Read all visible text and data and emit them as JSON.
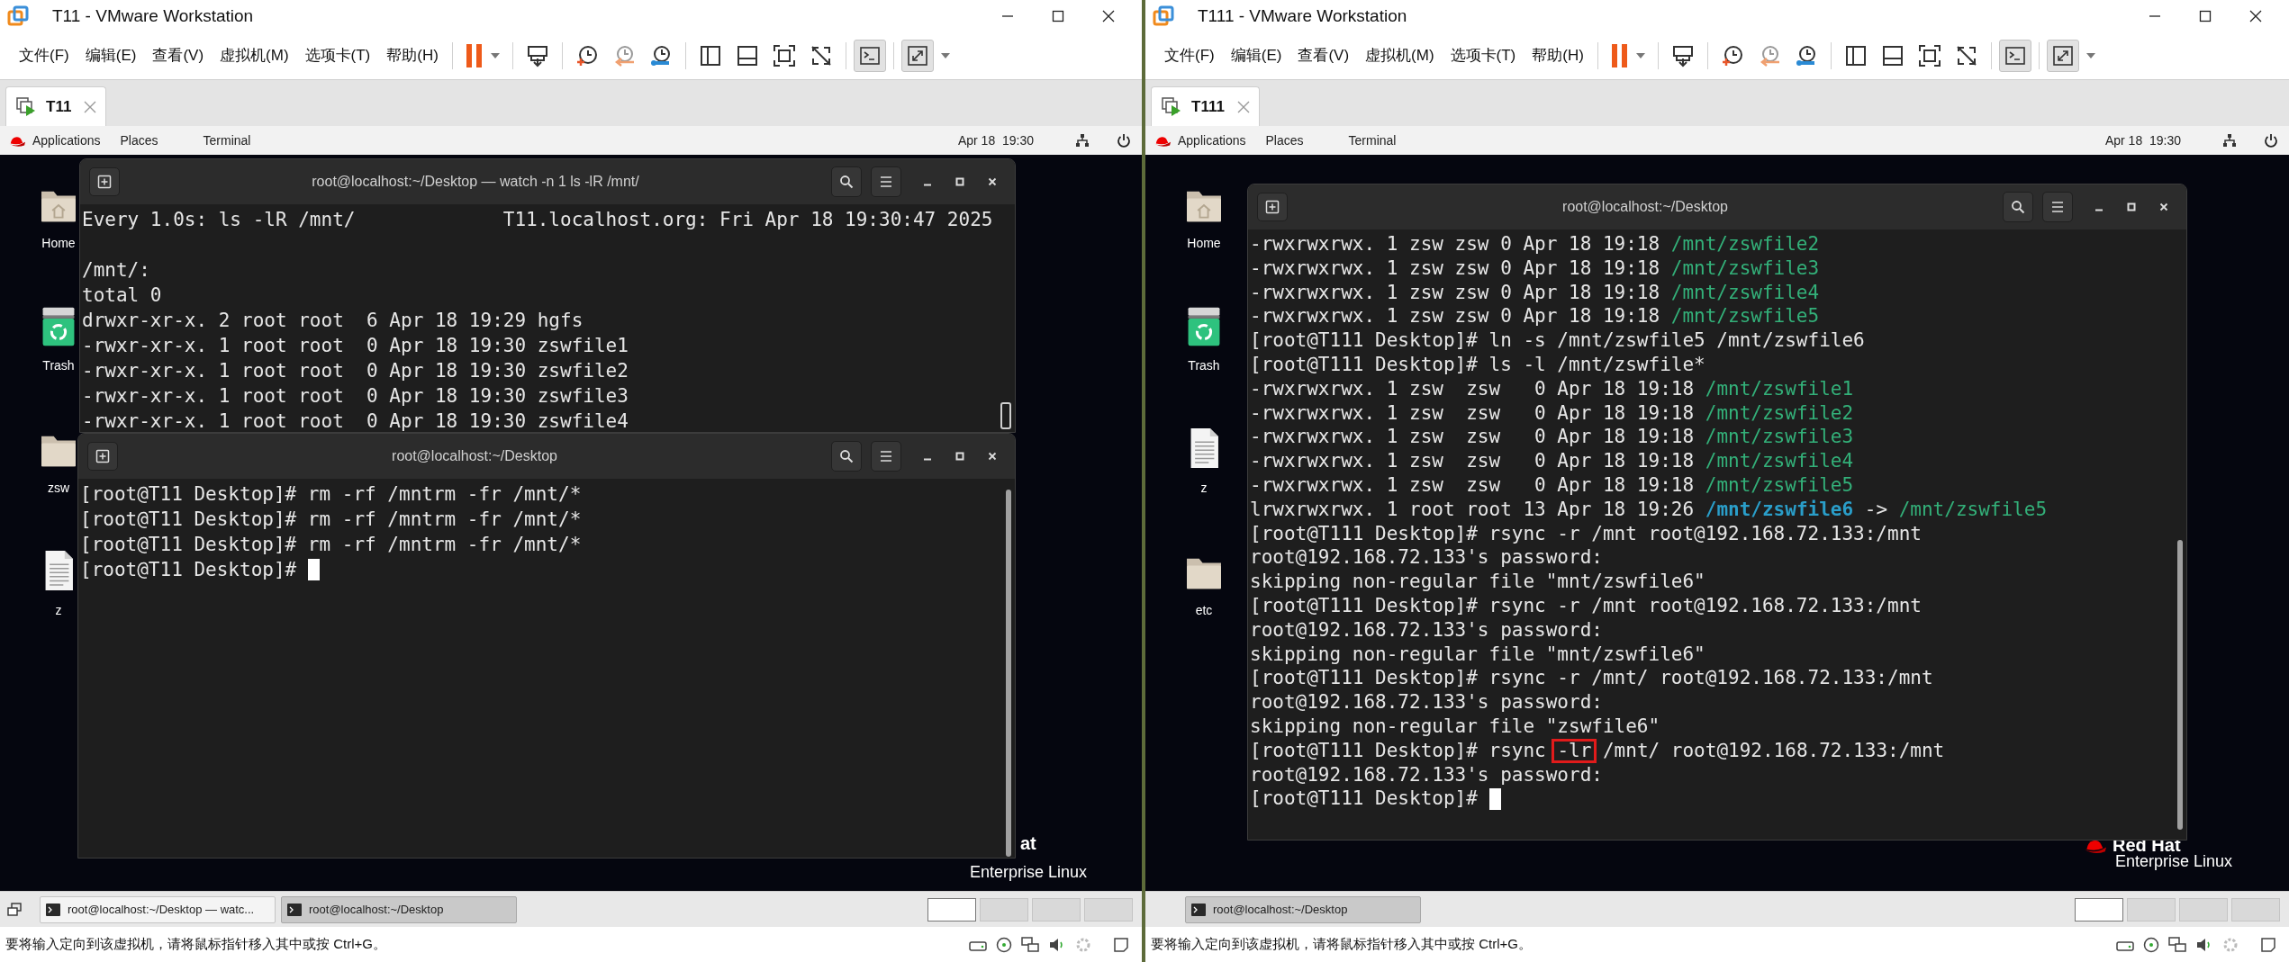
{
  "windows": [
    {
      "title": "T11 - VMware Workstation",
      "menus": [
        "文件(F)",
        "编辑(E)",
        "查看(V)",
        "虚拟机(M)",
        "选项卡(T)",
        "帮助(H)"
      ],
      "tabs": [
        {
          "label": "T11",
          "selected": true
        }
      ],
      "guest": {
        "top_bar": {
          "items": [
            "Applications",
            "Places",
            "Terminal"
          ],
          "clock": "Apr 18  19:30"
        },
        "desktop_icons": [
          {
            "label": "Home",
            "kind": "home"
          },
          {
            "label": "Trash",
            "kind": "trash"
          },
          {
            "label": "zsw",
            "kind": "folder"
          },
          {
            "label": "z",
            "kind": "file"
          }
        ],
        "terminals": [
          {
            "title": "root@localhost:~/Desktop — watch -n 1 ls -lR /mnt/",
            "cursor": false,
            "lines": [
              "Every 1.0s: ls -lR /mnt/             T11.localhost.org: Fri Apr 18 19:30:47 2025",
              {
                "kind": "blank"
              },
              "/mnt/:",
              "total 0",
              "drwxr-xr-x. 2 root root  6 Apr 18 19:29 hgfs",
              "-rwxr-xr-x. 1 root root  0 Apr 18 19:30 zswfile1",
              "-rwxr-xr-x. 1 root root  0 Apr 18 19:30 zswfile2",
              "-rwxr-xr-x. 1 root root  0 Apr 18 19:30 zswfile3",
              "-rwxr-xr-x. 1 root root  0 Apr 18 19:30 zswfile4"
            ]
          },
          {
            "title": "root@localhost:~/Desktop",
            "cursor": true,
            "lines": [
              "[root@T11 Desktop]# rm -rf /mntrm -fr /mnt/*",
              "[root@T11 Desktop]# rm -rf /mntrm -fr /mnt/*",
              "[root@T11 Desktop]# rm -rf /mntrm -fr /mnt/*",
              "[root@T11 Desktop]# "
            ]
          }
        ],
        "logo": {
          "brand": "at",
          "product": "Enterprise Linux"
        },
        "taskbar": {
          "items": [
            {
              "label": "root@localhost:~/Desktop — watc...",
              "selected": false
            },
            {
              "label": "root@localhost:~/Desktop",
              "selected": true
            }
          ],
          "workspaces": [
            {
              "selected": true
            },
            {
              "selected": false
            },
            {
              "selected": false
            },
            {
              "selected": false
            }
          ]
        }
      },
      "status_bar": "要将输入定向到该虚拟机，请将鼠标指针移入其中或按 Ctrl+G。"
    },
    {
      "title": "T111 - VMware Workstation",
      "menus": [
        "文件(F)",
        "编辑(E)",
        "查看(V)",
        "虚拟机(M)",
        "选项卡(T)",
        "帮助(H)"
      ],
      "tabs": [
        {
          "label": "T111",
          "selected": true
        }
      ],
      "guest": {
        "top_bar": {
          "items": [
            "Applications",
            "Places",
            "Terminal"
          ],
          "clock": "Apr 18  19:30"
        },
        "desktop_icons": [
          {
            "label": "Home",
            "kind": "home"
          },
          {
            "label": "Trash",
            "kind": "trash"
          },
          {
            "label": "z",
            "kind": "file"
          },
          {
            "label": "etc",
            "kind": "folder"
          }
        ],
        "terminals": [
          {
            "title": "root@localhost:~/Desktop",
            "cursor": true,
            "lines": [
              {
                "kind": "colored",
                "segments": [
                  {
                    "text": "-rwxrwxrwx. 1 zsw zsw 0 Apr 18 19:18 ",
                    "kind": "plain"
                  },
                  {
                    "text": "/mnt/zswfile2",
                    "kind": "file"
                  }
                ]
              },
              {
                "kind": "colored",
                "segments": [
                  {
                    "text": "-rwxrwxrwx. 1 zsw zsw 0 Apr 18 19:18 ",
                    "kind": "plain"
                  },
                  {
                    "text": "/mnt/zswfile3",
                    "kind": "file"
                  }
                ]
              },
              {
                "kind": "colored",
                "segments": [
                  {
                    "text": "-rwxrwxrwx. 1 zsw zsw 0 Apr 18 19:18 ",
                    "kind": "plain"
                  },
                  {
                    "text": "/mnt/zswfile4",
                    "kind": "file"
                  }
                ]
              },
              {
                "kind": "colored",
                "segments": [
                  {
                    "text": "-rwxrwxrwx. 1 zsw zsw 0 Apr 18 19:18 ",
                    "kind": "plain"
                  },
                  {
                    "text": "/mnt/zswfile5",
                    "kind": "file"
                  }
                ]
              },
              "[root@T111 Desktop]# ln -s /mnt/zswfile5 /mnt/zswfile6",
              "[root@T111 Desktop]# ls -l /mnt/zswfile*",
              {
                "kind": "colored",
                "segments": [
                  {
                    "text": "-rwxrwxrwx. 1 zsw  zsw   0 Apr 18 19:18 ",
                    "kind": "plain"
                  },
                  {
                    "text": "/mnt/zswfile1",
                    "kind": "file"
                  }
                ]
              },
              {
                "kind": "colored",
                "segments": [
                  {
                    "text": "-rwxrwxrwx. 1 zsw  zsw   0 Apr 18 19:18 ",
                    "kind": "plain"
                  },
                  {
                    "text": "/mnt/zswfile2",
                    "kind": "file"
                  }
                ]
              },
              {
                "kind": "colored",
                "segments": [
                  {
                    "text": "-rwxrwxrwx. 1 zsw  zsw   0 Apr 18 19:18 ",
                    "kind": "plain"
                  },
                  {
                    "text": "/mnt/zswfile3",
                    "kind": "file"
                  }
                ]
              },
              {
                "kind": "colored",
                "segments": [
                  {
                    "text": "-rwxrwxrwx. 1 zsw  zsw   0 Apr 18 19:18 ",
                    "kind": "plain"
                  },
                  {
                    "text": "/mnt/zswfile4",
                    "kind": "file"
                  }
                ]
              },
              {
                "kind": "colored",
                "segments": [
                  {
                    "text": "-rwxrwxrwx. 1 zsw  zsw   0 Apr 18 19:18 ",
                    "kind": "plain"
                  },
                  {
                    "text": "/mnt/zswfile5",
                    "kind": "file"
                  }
                ]
              },
              {
                "kind": "colored",
                "segments": [
                  {
                    "text": "lrwxrwxrwx. 1 root root 13 Apr 18 19:26 ",
                    "kind": "plain"
                  },
                  {
                    "text": "/mnt/zswfile6",
                    "kind": "symlink"
                  },
                  {
                    "text": " -> ",
                    "kind": "plain"
                  },
                  {
                    "text": "/mnt/zswfile5",
                    "kind": "file"
                  }
                ]
              },
              "[root@T111 Desktop]# rsync -r /mnt root@192.168.72.133:/mnt",
              "root@192.168.72.133's password:",
              "skipping non-regular file \"mnt/zswfile6\"",
              "[root@T111 Desktop]# rsync -r /mnt root@192.168.72.133:/mnt",
              "root@192.168.72.133's password:",
              "skipping non-regular file \"mnt/zswfile6\"",
              "[root@T111 Desktop]# rsync -r /mnt/ root@192.168.72.133:/mnt",
              "root@192.168.72.133's password:",
              "skipping non-regular file \"zswfile6\"",
              {
                "kind": "colored",
                "segments": [
                  {
                    "text": "[root@T111 Desktop]# rsync ",
                    "kind": "plain"
                  },
                  {
                    "text": "-lr",
                    "kind": "boxed"
                  },
                  {
                    "text": " /mnt/ root@192.168.72.133:/mnt",
                    "kind": "plain"
                  }
                ]
              },
              "root@192.168.72.133's password:",
              "[root@T111 Desktop]# "
            ]
          }
        ],
        "logo": {
          "brand": "Red Hat",
          "product": "Enterprise Linux"
        },
        "taskbar": {
          "items": [
            {
              "label": "root@localhost:~/Desktop",
              "selected": true
            }
          ],
          "workspaces": [
            {
              "selected": true
            },
            {
              "selected": false
            },
            {
              "selected": false
            },
            {
              "selected": false
            }
          ]
        }
      },
      "status_bar": "要将输入定向到该虚拟机，请将鼠标指针移入其中或按 Ctrl+G。"
    }
  ]
}
